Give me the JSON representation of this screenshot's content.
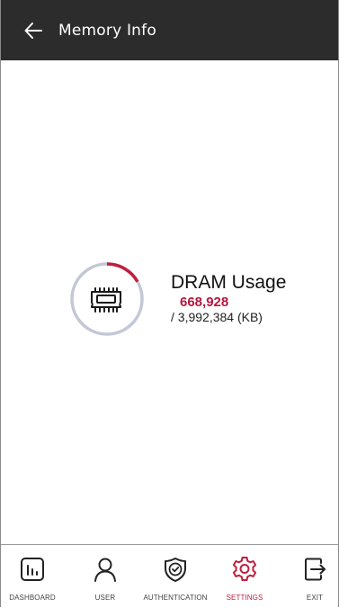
{
  "header": {
    "title": "Memory Info",
    "back_icon": "back-arrow-icon"
  },
  "memory": {
    "title": "DRAM Usage",
    "used": "668,928",
    "total": "/ 3,992,384 (KB)",
    "used_kb": 668928,
    "total_kb": 3992384,
    "icon": "memory-chip-icon"
  },
  "colors": {
    "header_bg": "#2c2c2c",
    "accent": "#c0203f",
    "gauge_track": "#c3c8d6"
  },
  "nav": {
    "active": "SETTINGS",
    "items": [
      {
        "label": "DASHBOARD",
        "icon": "dashboard-icon"
      },
      {
        "label": "USER",
        "icon": "user-icon"
      },
      {
        "label": "AUTHENTICATION",
        "icon": "authentication-check-icon"
      },
      {
        "label": "SETTINGS",
        "icon": "settings-gear-icon"
      },
      {
        "label": "EXIT",
        "icon": "exit-icon"
      }
    ]
  }
}
